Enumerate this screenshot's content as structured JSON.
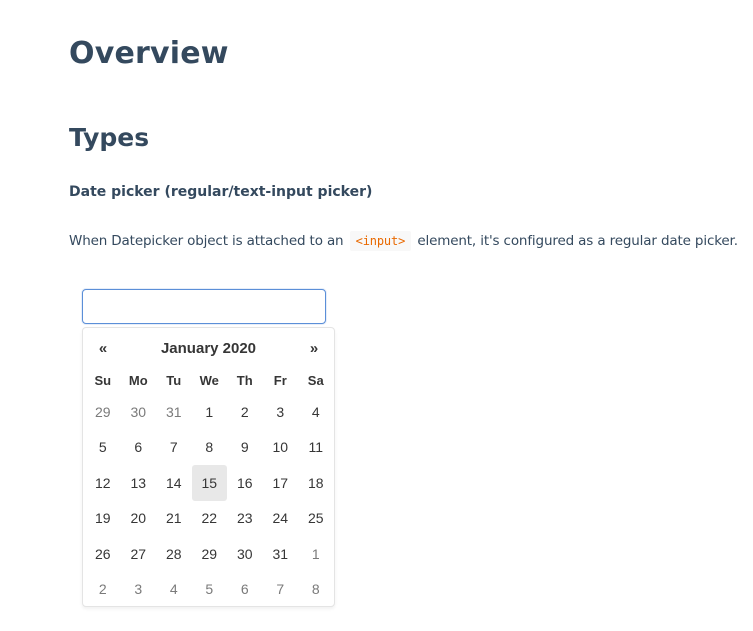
{
  "headings": {
    "overview": "Overview",
    "types": "Types",
    "subsection": "Date picker (regular/text-input picker)"
  },
  "paragraph": {
    "before": "When Datepicker object is attached to an",
    "code": "<input>",
    "after": "element, it's configured as a regular date picker."
  },
  "input": {
    "value": "",
    "placeholder": ""
  },
  "datepicker": {
    "title": "January 2020",
    "prev_label": "«",
    "next_label": "»",
    "days_of_week": [
      "Su",
      "Mo",
      "Tu",
      "We",
      "Th",
      "Fr",
      "Sa"
    ],
    "focused_date": "15",
    "weeks": [
      [
        {
          "d": "29",
          "other": true
        },
        {
          "d": "30",
          "other": true
        },
        {
          "d": "31",
          "other": true
        },
        {
          "d": "1"
        },
        {
          "d": "2"
        },
        {
          "d": "3"
        },
        {
          "d": "4"
        }
      ],
      [
        {
          "d": "5"
        },
        {
          "d": "6"
        },
        {
          "d": "7"
        },
        {
          "d": "8"
        },
        {
          "d": "9"
        },
        {
          "d": "10"
        },
        {
          "d": "11"
        }
      ],
      [
        {
          "d": "12"
        },
        {
          "d": "13"
        },
        {
          "d": "14"
        },
        {
          "d": "15",
          "focused": true
        },
        {
          "d": "16"
        },
        {
          "d": "17"
        },
        {
          "d": "18"
        }
      ],
      [
        {
          "d": "19"
        },
        {
          "d": "20"
        },
        {
          "d": "21"
        },
        {
          "d": "22"
        },
        {
          "d": "23"
        },
        {
          "d": "24"
        },
        {
          "d": "25"
        }
      ],
      [
        {
          "d": "26"
        },
        {
          "d": "27"
        },
        {
          "d": "28"
        },
        {
          "d": "29"
        },
        {
          "d": "30"
        },
        {
          "d": "31"
        },
        {
          "d": "1",
          "other": true
        }
      ],
      [
        {
          "d": "2",
          "other": true
        },
        {
          "d": "3",
          "other": true
        },
        {
          "d": "4",
          "other": true
        },
        {
          "d": "5",
          "other": true
        },
        {
          "d": "6",
          "other": true
        },
        {
          "d": "7",
          "other": true
        },
        {
          "d": "8",
          "other": true
        }
      ]
    ]
  },
  "colors": {
    "heading": "#34495e",
    "code_text": "#e96900",
    "code_bg": "#f8f8f8",
    "input_focus_border": "#5b8fd8",
    "focused_day_bg": "#e8e8e8"
  }
}
